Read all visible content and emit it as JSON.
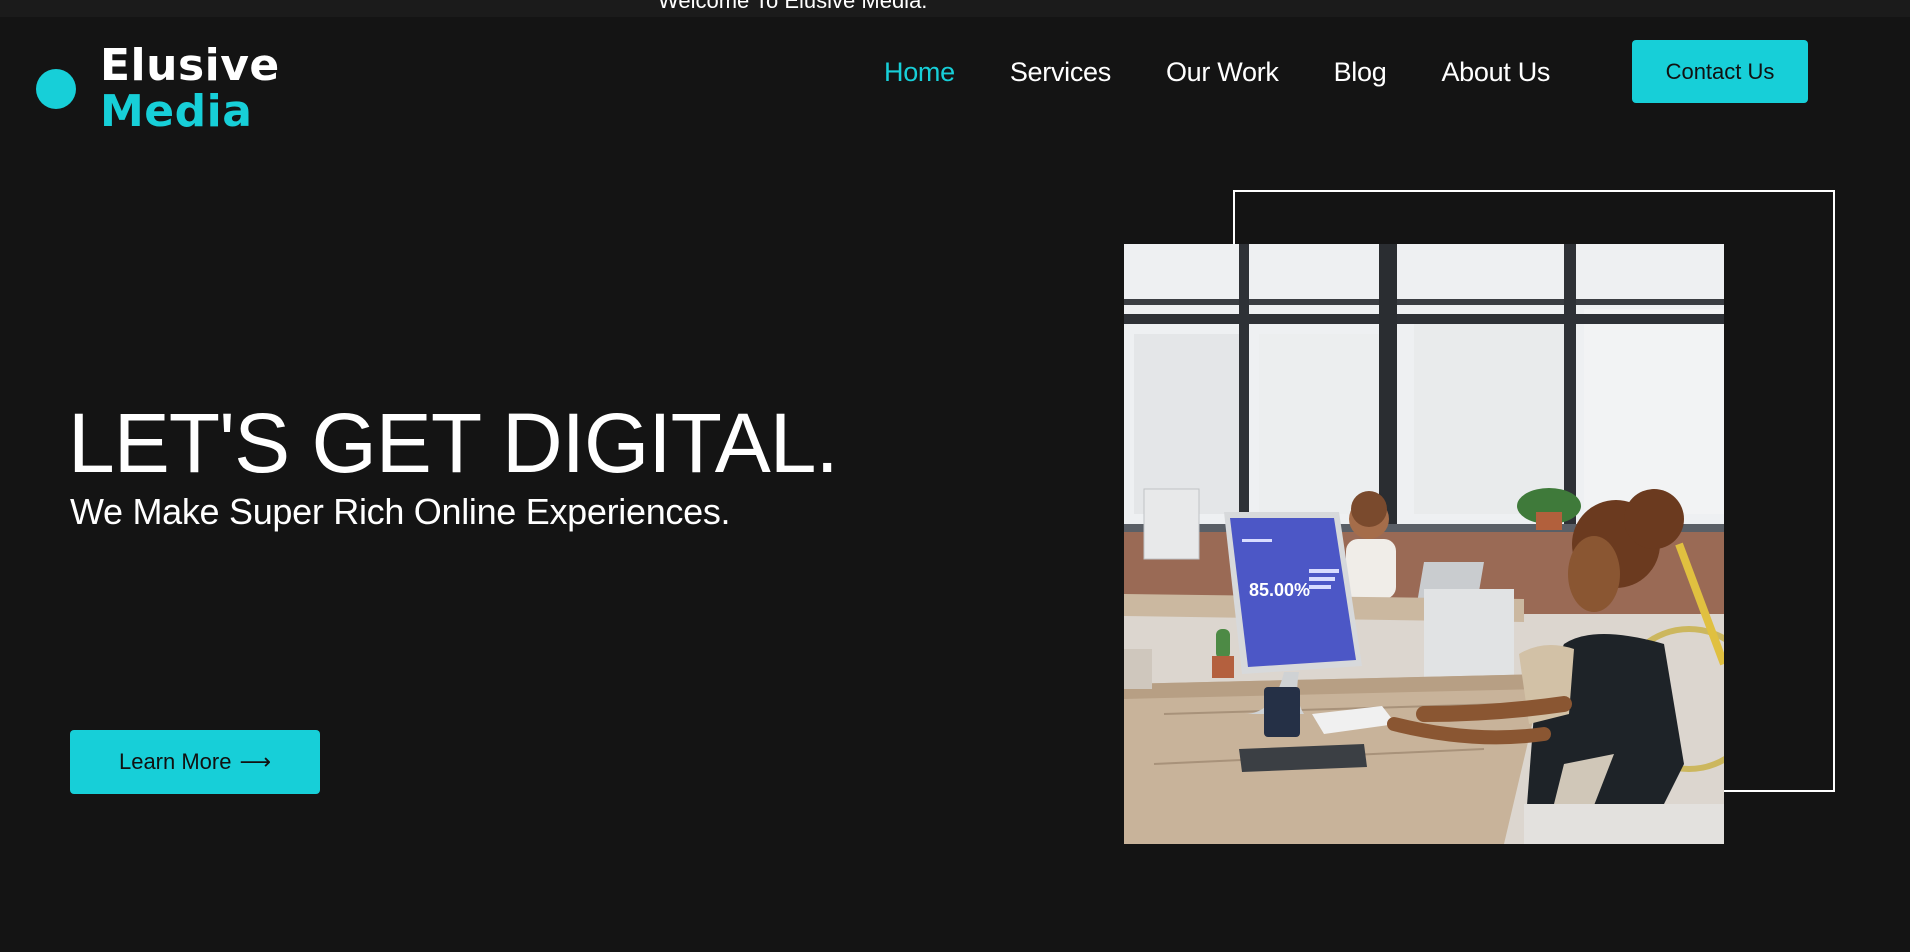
{
  "announcement": {
    "text": "Welcome To Elusive Media."
  },
  "logo": {
    "line1": "Elusive",
    "line2": "Media"
  },
  "nav": {
    "items": [
      {
        "label": "Home",
        "active": true
      },
      {
        "label": "Services",
        "active": false
      },
      {
        "label": "Our Work",
        "active": false
      },
      {
        "label": "Blog",
        "active": false
      },
      {
        "label": "About Us",
        "active": false
      }
    ],
    "contact_label": "Contact Us"
  },
  "hero": {
    "title": "LET'S GET DIGITAL.",
    "subtitle": "We Make Super Rich Online Experiences.",
    "cta_label": "Learn More",
    "cta_icon": "arrow-right-icon",
    "photo_screen_value": "85.00%"
  },
  "colors": {
    "background": "#141414",
    "accent": "#17cfd8",
    "text": "#ffffff"
  }
}
